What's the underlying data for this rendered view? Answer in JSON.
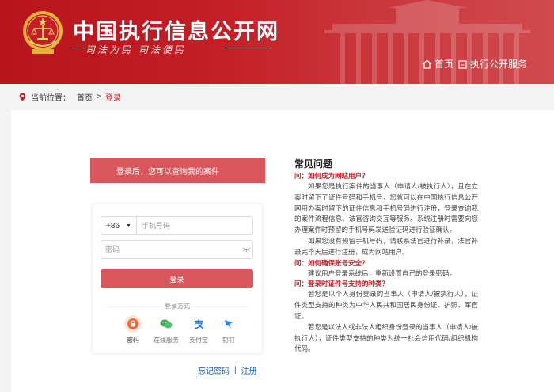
{
  "header": {
    "title": "中国执行信息公开网",
    "slogan": "司法为民  司法便民",
    "nav": [
      {
        "label": "首页",
        "icon": "home-icon"
      },
      {
        "label": "执行公开服务",
        "icon": "building-icon"
      }
    ],
    "brand_color": "#c41e26"
  },
  "breadcrumb": {
    "prefix": "当前位置：",
    "home": "首页",
    "separator": ">",
    "current": "登录"
  },
  "login": {
    "notice": "登录后，您可以查询我的案件",
    "country_code": "+86",
    "phone_placeholder": "手机号码",
    "password_placeholder": "密码",
    "submit": "登录",
    "methods_title": "登录方式",
    "methods": [
      {
        "label": "密码",
        "icon": "lock-icon",
        "color": "#f36b3b",
        "active": true
      },
      {
        "label": "在线服务",
        "icon": "chat-icon",
        "color": "#3aa857",
        "active": false
      },
      {
        "label": "支付宝",
        "icon": "alipay-icon",
        "color": "#1677ff",
        "active": false
      },
      {
        "label": "钉钉",
        "icon": "dingtalk-icon",
        "color": "#1a8cff",
        "active": false
      }
    ],
    "forgot_password": "忘记密码",
    "link_separator": "|",
    "register": "注册",
    "accent_color": "#d9575c"
  },
  "faq": {
    "title": "常见问题",
    "items": [
      {
        "q": "问：如何成为网站用户？",
        "a": [
          "如果您是执行案件的当事人（申请人/被执行人），且在立案时留下了证件号码和手机号，您就可以在中国执行信息公开网用办案时留下的证件信息和手机号码进行注册，登录查询我的案件流程信息、法官咨询交互等服务。系统注册时需要向您办理案件时预留的手机号码发送验证码进行验证确认。",
          "如果您没有预留手机号码，请联系法官进行补录，法官补录完毕天后进行注册，成为网站用户。"
        ]
      },
      {
        "q": "问：如何确保账号安全？",
        "a": [
          "建议用户登录系统后，重新设置自己的登录密码。"
        ]
      },
      {
        "q": "问：登录时证件号支持的种类？",
        "a": [
          "若您是以个人身份登录的当事人（申请人/被执行人），证件类型支持的种类为中华人民共和国居民身份证、护照、军官证。",
          "若您是以法人或非法人组织身份登录的当事人（申请人/被执行人），证件类型支持的种类为统一社会信用代码/组织机构代码。"
        ]
      }
    ]
  }
}
